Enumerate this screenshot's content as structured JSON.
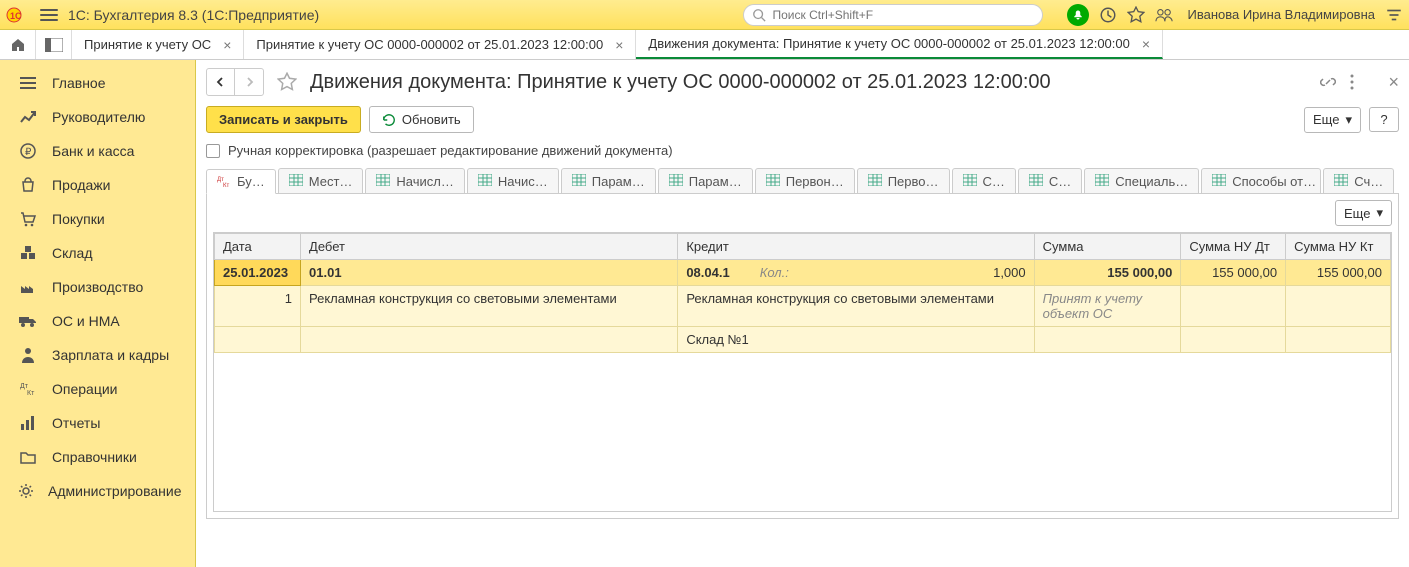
{
  "app": {
    "title": "1С: Бухгалтерия 8.3  (1С:Предприятие)"
  },
  "search": {
    "placeholder": "Поиск Ctrl+Shift+F"
  },
  "user": {
    "name": "Иванова Ирина Владимировна"
  },
  "tabs": [
    {
      "label": "Принятие к учету ОС"
    },
    {
      "label": "Принятие к учету ОС 0000-000002 от 25.01.2023 12:00:00"
    },
    {
      "label": "Движения документа: Принятие к учету ОС 0000-000002 от 25.01.2023 12:00:00"
    }
  ],
  "sidebar": {
    "items": [
      "Главное",
      "Руководителю",
      "Банк и касса",
      "Продажи",
      "Покупки",
      "Склад",
      "Производство",
      "ОС и НМА",
      "Зарплата и кадры",
      "Операции",
      "Отчеты",
      "Справочники",
      "Администрирование"
    ]
  },
  "page": {
    "title": "Движения документа: Принятие к учету ОС 0000-000002 от 25.01.2023 12:00:00",
    "save_close": "Записать и закрыть",
    "refresh": "Обновить",
    "more": "Еще",
    "help": "?",
    "manual_edit": "Ручная корректировка (разрешает редактирование движений документа)"
  },
  "subtabs": [
    "Бу…",
    "Мест…",
    "Начисл…",
    "Начис…",
    "Парам…",
    "Парам…",
    "Первон…",
    "Перво…",
    "С…",
    "С…",
    "Специаль…",
    "Способы от…",
    "Сч…"
  ],
  "table": {
    "headers": {
      "date": "Дата",
      "debit": "Дебет",
      "credit": "Кредит",
      "sum": "Сумма",
      "sum_nu_dt": "Сумма НУ Дт",
      "sum_nu_kt": "Сумма НУ Кт"
    },
    "row1": {
      "date": "25.01.2023",
      "debit_acc": "01.01",
      "credit_acc": "08.04.1",
      "qty_label": "Кол.:",
      "qty_val": "1,000",
      "sum": "155 000,00",
      "sum_nu_dt": "155 000,00",
      "sum_nu_kt": "155 000,00"
    },
    "row2": {
      "line_no": "1",
      "debit_desc": "Рекламная конструкция со световыми элементами",
      "credit_desc": "Рекламная конструкция со световыми элементами",
      "sum_note": "Принят к учету объект ОС"
    },
    "row3": {
      "credit_wh": "Склад №1"
    }
  }
}
